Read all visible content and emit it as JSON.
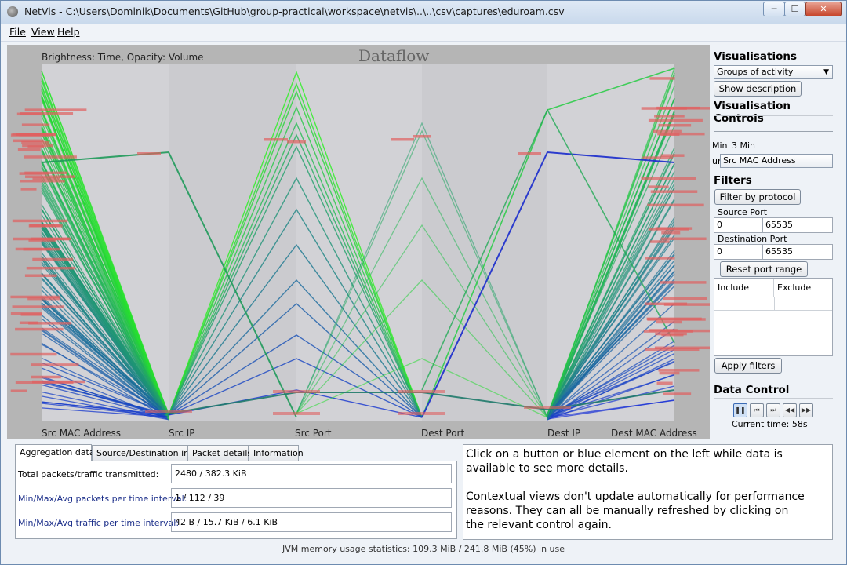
{
  "window": {
    "title": "NetVis - C:\\Users\\Dominik\\Documents\\GitHub\\group-practical\\workspace\\netvis\\..\\..\\csv\\captures\\eduroam.csv",
    "minimize": "─",
    "maximize": "☐",
    "close": "✕"
  },
  "menu": [
    "File",
    "View",
    "Help"
  ],
  "viz": {
    "hint": "Brightness: Time, Opacity: Volume",
    "title": "Dataflow",
    "axes": [
      "Src MAC Address",
      "Src IP",
      "Src Port",
      "Dest Port",
      "Dest IP",
      "Dest MAC Address"
    ]
  },
  "right": {
    "visualisations_title": "Visualisations",
    "vis_select": "Groups of activity",
    "show_description": "Show description",
    "controls_title": "Visualisation Controls",
    "slider_left": "Min",
    "slider_value": "3 Min",
    "attr_label": "ur",
    "attr_select": "Src MAC Address",
    "filters_title": "Filters",
    "filter_protocol": "Filter by protocol",
    "source_port_label": "Source Port",
    "source_port_from": "0",
    "source_port_to": "65535",
    "dest_port_label": "Destination Port",
    "dest_port_from": "0",
    "dest_port_to": "65535",
    "reset_port": "Reset port range",
    "include": "Include",
    "exclude": "Exclude",
    "apply_filters": "Apply filters",
    "data_control_title": "Data Control",
    "current_time": "Current time: 58s"
  },
  "tabs": [
    "Aggregation data",
    "Source/Destination info",
    "Packet details",
    "Information"
  ],
  "aggregation": {
    "total_label": "Total packets/traffic transmitted:",
    "total_value": "2480 / 382.3 KiB",
    "packets_label": "Min/Max/Avg packets per time interval:",
    "packets_value": "1 / 112 / 39",
    "traffic_label": "Min/Max/Avg traffic per time interval:",
    "traffic_value": "42 B / 15.7 KiB / 6.1 KiB"
  },
  "info": {
    "line1": "Click on a button or blue element on the left while data is",
    "line2": "available to see more details.",
    "line3": "Contextual views don't update automatically for performance",
    "line4": "reasons. They can all be manually refreshed by clicking on",
    "line5": "the relevant control again."
  },
  "status": "JVM memory usage statistics: 109.3 MiB / 241.8 MiB (45%) in use",
  "colors": {
    "accent_green": "#22dd22",
    "accent_blue": "#1a1acc",
    "highlight_red": "#e06060"
  }
}
